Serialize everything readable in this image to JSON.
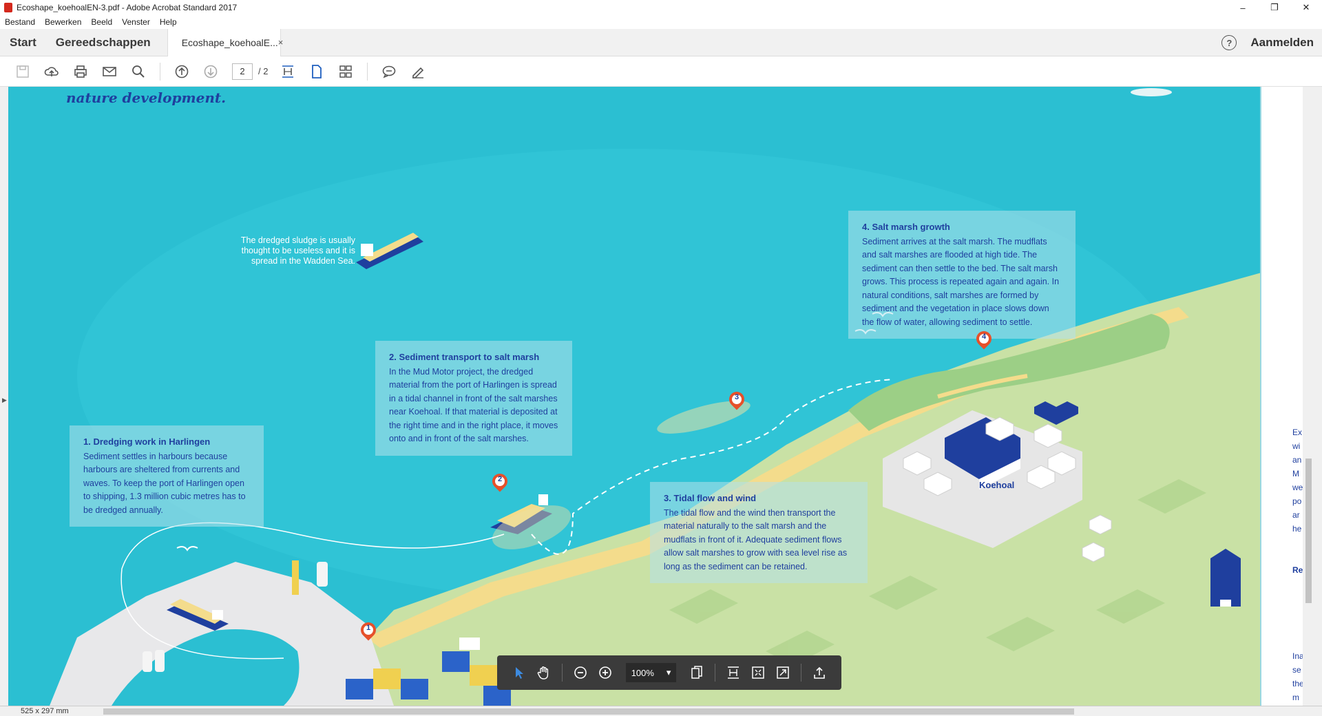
{
  "window": {
    "title": "Ecoshape_koehoalEN-3.pdf - Adobe Acrobat Standard 2017",
    "controls": [
      "–",
      "❐",
      "✕"
    ]
  },
  "menu": [
    "Bestand",
    "Bewerken",
    "Beeld",
    "Venster",
    "Help"
  ],
  "tabs": {
    "start": "Start",
    "tools": "Gereedschappen",
    "document": "Ecoshape_koehoalE...",
    "close": "×"
  },
  "account": {
    "help": "?",
    "signin": "Aanmelden"
  },
  "toolbar": {
    "page_current": "2",
    "page_total": "/ 2"
  },
  "document": {
    "top_text": "nature development.",
    "sludge_text": "The dredged sludge is usually thought to be useless and it is spread in the Wadden Sea.",
    "boxes": [
      {
        "title": "1. Dredging work in Harlingen",
        "body": "Sediment settles in harbours because harbours are sheltered from currents and waves. To keep the port of Harlingen open to shipping, 1.3 million cubic metres has to be dredged annually."
      },
      {
        "title": "2. Sediment transport to salt marsh",
        "body": "In the Mud Motor project, the dredged material from the port of Harlingen is spread in a tidal channel in front of the salt marshes near Koehoal. If that material is deposited at the right time and in the right place, it moves onto and in front of the salt marshes."
      },
      {
        "title": "3. Tidal flow and wind",
        "body": "The tidal flow and the wind then transport the material naturally to the salt marsh and the mudflats in front of it. Adequate sediment flows allow salt marshes to grow with sea level rise as long as the sediment can be retained."
      },
      {
        "title": "4. Salt marsh growth",
        "body": "Sediment arrives at the salt marsh. The mudflats and salt marshes are flooded at high tide. The sediment can then settle to the bed. The salt marsh grows. This process is repeated again and again. In natural conditions, salt marshes are formed by sediment and the vegetation in place slows down the flow of water, allowing sediment to settle."
      }
    ],
    "place_label": "Koehoal",
    "markers": [
      "1",
      "2",
      "3",
      "4"
    ],
    "side_text": [
      "Ex",
      "wi",
      "an",
      "M",
      "we",
      "po",
      "ar",
      "he",
      "Re",
      "Ina",
      "se",
      "the",
      "m"
    ]
  },
  "floating_toolbar": {
    "zoom": "100%"
  },
  "status": {
    "page_size": "525 x 297 mm"
  },
  "colors": {
    "sea": "#2bbfd2",
    "land": "#c5dfa0",
    "sand": "#f4dc8c",
    "text_blue": "#1f3f9e",
    "marker": "#e6502a"
  }
}
